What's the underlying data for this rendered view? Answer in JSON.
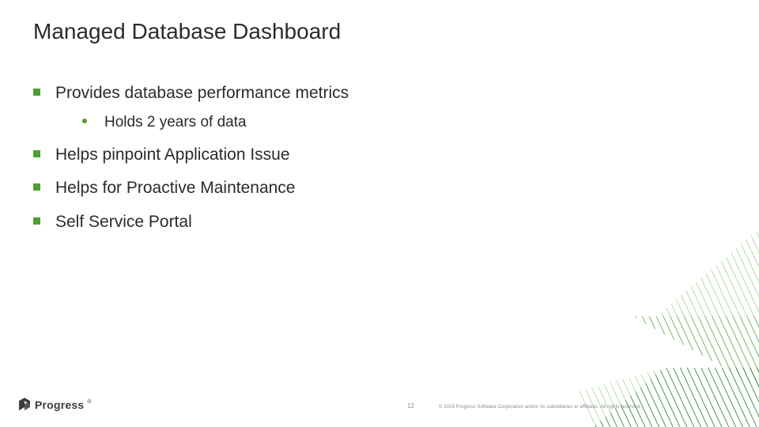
{
  "title": "Managed Database Dashboard",
  "bullets": [
    {
      "text": "Provides database performance metrics",
      "subs": [
        "Holds 2 years of data"
      ]
    },
    {
      "text": "Helps pinpoint Application Issue",
      "subs": []
    },
    {
      "text": "Helps for Proactive Maintenance",
      "subs": []
    },
    {
      "text": "Self Service Portal",
      "subs": []
    }
  ],
  "footer": {
    "logo_text": "Progress",
    "page_number": "12",
    "copyright": "© 2016 Progress Software Corporation and/or its subsidiaries or affiliates. All rights reserved."
  },
  "colors": {
    "accent": "#4f9e33",
    "text": "#2b2b2b"
  }
}
